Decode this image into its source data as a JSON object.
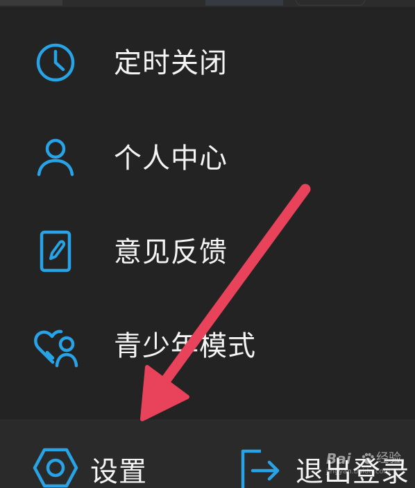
{
  "menu": {
    "items": [
      {
        "label": "定时关闭",
        "icon": "clock-icon"
      },
      {
        "label": "个人中心",
        "icon": "user-icon"
      },
      {
        "label": "意见反馈",
        "icon": "feedback-edit-icon"
      },
      {
        "label": "青少年模式",
        "icon": "heart-user-icon"
      }
    ]
  },
  "bottom_bar": {
    "settings_label": "设置",
    "settings_icon": "hexagon-settings-icon",
    "logout_label": "退出登录",
    "logout_icon": "logout-arrow-icon"
  },
  "watermark": {
    "brand": "Bai",
    "jingyan": "经验",
    "url": "jingyan.baidu.com"
  },
  "colors": {
    "background": "#232323",
    "icon_accent": "#27a3e6",
    "annotation_arrow": "#e8435a",
    "text": "#f4f4f4"
  }
}
